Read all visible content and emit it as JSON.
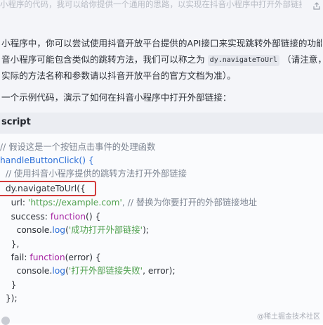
{
  "header": {
    "truncated_text": "小程序的代码，我可以给你提供一个通用的思路，以实现在抖音小程序中打开外部链接"
  },
  "answer": {
    "p1": "小程序中，你可以尝试使用抖音开放平台提供的API接口来实现跳转外部链接的功能。根",
    "p2_before": "音小程序可能包含类似的跳转方法，我们可以称之为",
    "p2_code": "dy.navigateToUrl",
    "p2_after": "（请注意，这只是",
    "p3": "实际的方法名称和参数请以抖音开放平台的官方文档为准）。",
    "p4": "一个示例代码，演示了如何在抖音小程序中打开外部链接："
  },
  "code_block": {
    "language": "script",
    "lines": {
      "l1": "// 假设这是一个按钮点击事件的处理函数",
      "l2": "handleButtonClick() {",
      "l3": "  // 使用抖音小程序提供的跳转方法打开外部链接",
      "l4": "  dy.navigateToUrl({",
      "l5a": "    url: ",
      "l5b": "'https://example.com'",
      "l5c": ", // 替换为你要打开的外部链接地址",
      "l6a": "    success: ",
      "l6b": "function",
      "l6c": "() {",
      "l7a": "      console.",
      "l7b": "log",
      "l7c": "(",
      "l7d": "'成功打开外部链接'",
      "l7e": ");",
      "l8": "    },",
      "l9a": "    fail: ",
      "l9b": "function",
      "l9c": "(error) {",
      "l10a": "      console.",
      "l10b": "log",
      "l10c": "(",
      "l10d": "'打开外部链接失败'",
      "l10e": ", error);",
      "l11": "    }",
      "l12": "  });"
    }
  },
  "watermark": "@稀土掘金技术社区",
  "colors": {
    "highlight_box": "#d23b3b",
    "keyword": "#a626a4",
    "string": "#50a14f",
    "function": "#2c6fd8",
    "comment": "#7d8592"
  }
}
